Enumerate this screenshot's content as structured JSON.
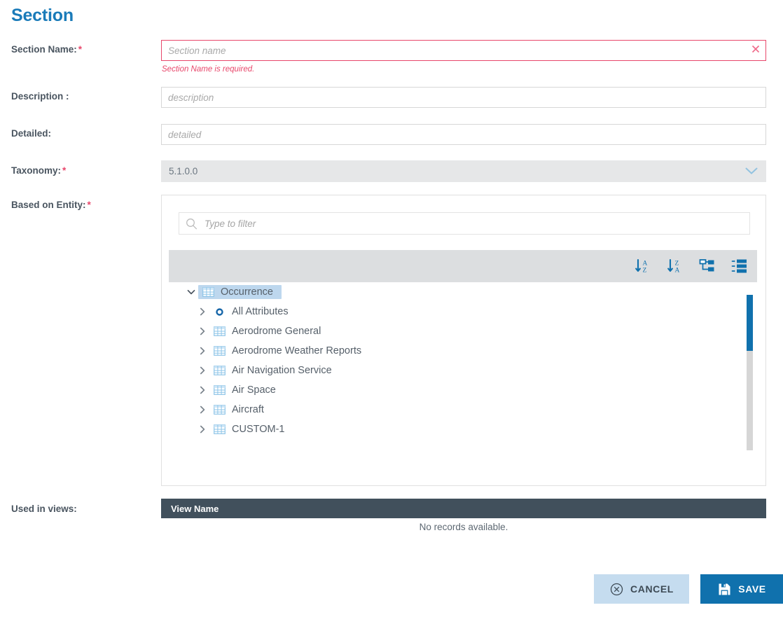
{
  "page": {
    "title": "Section",
    "title_color": "#1a7bb9"
  },
  "fields": {
    "section_name": {
      "label": "Section Name:",
      "required": true,
      "value": "",
      "placeholder": "Section name",
      "error": "Section Name is required.",
      "error_color": "#e8476b",
      "clear_icon": "close-icon"
    },
    "description": {
      "label": "Description :",
      "required": false,
      "value": "",
      "placeholder": "description"
    },
    "detailed": {
      "label": "Detailed:",
      "required": false,
      "value": "",
      "placeholder": "detailed"
    },
    "taxonomy": {
      "label": "Taxonomy:",
      "required": true,
      "value": "5.1.0.0",
      "disabled": true,
      "chevron_icon": "chevron-down-icon"
    },
    "based_on_entity": {
      "label": "Based on Entity:",
      "required": true
    },
    "used_in_views": {
      "label": "Used in views:"
    }
  },
  "entity_picker": {
    "filter": {
      "value": "",
      "placeholder": "Type to filter",
      "icon": "search-icon"
    },
    "toolbar": [
      {
        "name": "sort-ascending-icon",
        "title": "Sort A-Z"
      },
      {
        "name": "sort-descending-icon",
        "title": "Sort Z-A"
      },
      {
        "name": "tree-view-icon",
        "title": "Tree view"
      },
      {
        "name": "list-view-icon",
        "title": "List view"
      }
    ],
    "tree": [
      {
        "label": "Occurrence",
        "level": 0,
        "expanded": true,
        "selected": true,
        "icon": "table-icon"
      },
      {
        "label": "All Attributes",
        "level": 1,
        "expanded": false,
        "selected": false,
        "icon": "attribute-dot-icon"
      },
      {
        "label": "Aerodrome General",
        "level": 1,
        "expanded": false,
        "selected": false,
        "icon": "table-icon"
      },
      {
        "label": "Aerodrome Weather Reports",
        "level": 1,
        "expanded": false,
        "selected": false,
        "icon": "table-icon"
      },
      {
        "label": "Air Navigation Service",
        "level": 1,
        "expanded": false,
        "selected": false,
        "icon": "table-icon"
      },
      {
        "label": "Air Space",
        "level": 1,
        "expanded": false,
        "selected": false,
        "icon": "table-icon"
      },
      {
        "label": "Aircraft",
        "level": 1,
        "expanded": false,
        "selected": false,
        "icon": "table-icon"
      },
      {
        "label": "CUSTOM-1",
        "level": 1,
        "expanded": false,
        "selected": false,
        "icon": "table-icon"
      }
    ],
    "scrollbar": {
      "visible": true,
      "thumb_color": "#1071ad",
      "track_color": "#d6d6d6"
    }
  },
  "views_grid": {
    "columns": [
      "View Name"
    ],
    "rows": [],
    "empty_message": "No records available."
  },
  "footer": {
    "cancel": {
      "label": "CANCEL",
      "icon": "cancel-circle-icon",
      "bg": "#c5dcef"
    },
    "save": {
      "label": "SAVE",
      "icon": "save-floppy-icon",
      "bg": "#1071ad"
    }
  }
}
